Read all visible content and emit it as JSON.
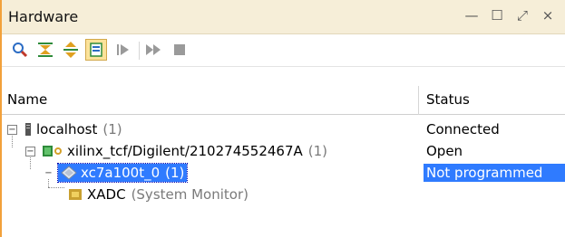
{
  "window": {
    "title": "Hardware",
    "controls": [
      {
        "name": "minimize-icon",
        "glyph": "—"
      },
      {
        "name": "maximize-icon",
        "glyph": "☐"
      },
      {
        "name": "float-icon",
        "glyph": "⤢"
      },
      {
        "name": "close-icon",
        "glyph": "×"
      }
    ]
  },
  "toolbar": {
    "buttons": [
      {
        "name": "search-icon"
      },
      {
        "name": "collapse-all-icon"
      },
      {
        "name": "expand-all-icon"
      },
      {
        "name": "auto-connect-icon",
        "active": true
      },
      {
        "name": "run-trigger-icon"
      },
      {
        "name": "run-trigger-immediate-icon"
      },
      {
        "name": "stop-trigger-icon"
      }
    ]
  },
  "table": {
    "columns": {
      "name": "Name",
      "status": "Status"
    },
    "rows": [
      {
        "label": "localhost",
        "count": "(1)",
        "status": "Connected",
        "icon": "server-icon",
        "expander": "−"
      },
      {
        "label": "xilinx_tcf/Digilent/210274552467A",
        "count": "(1)",
        "status": "Open",
        "icon": "jtag-cable-icon",
        "expander": "−"
      },
      {
        "label": "xc7a100t_0",
        "count": "(1)",
        "status": "Not programmed",
        "icon": "fpga-device-icon",
        "expander": "−",
        "selected": true
      },
      {
        "label": "XADC",
        "count": "(System Monitor)",
        "status": "",
        "icon": "xadc-icon"
      }
    ]
  },
  "colors": {
    "selection": "#2f7bff",
    "title_bar": "#f6eed8",
    "accent": "#f2a13b"
  }
}
